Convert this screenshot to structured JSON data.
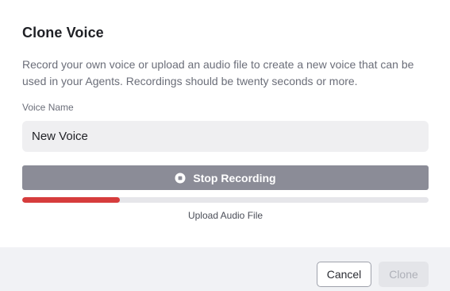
{
  "dialog": {
    "title": "Clone Voice",
    "description": "Record your own voice or upload an audio file to create a new voice that can be used in your Agents. Recordings should be twenty seconds or more.",
    "voice_name_label": "Voice Name",
    "voice_name_value": "New Voice",
    "stop_recording_label": "Stop Recording",
    "stop_icon": "stop-circle-icon",
    "recording_progress": 0.24,
    "upload_label": "Upload Audio File"
  },
  "footer": {
    "cancel_label": "Cancel",
    "clone_label": "Clone",
    "clone_disabled": true
  },
  "colors": {
    "progress_fill": "#d63c3c",
    "stop_button_bg": "#8b8c97",
    "input_bg": "#efeff1",
    "footer_bg": "#f1f2f5"
  }
}
